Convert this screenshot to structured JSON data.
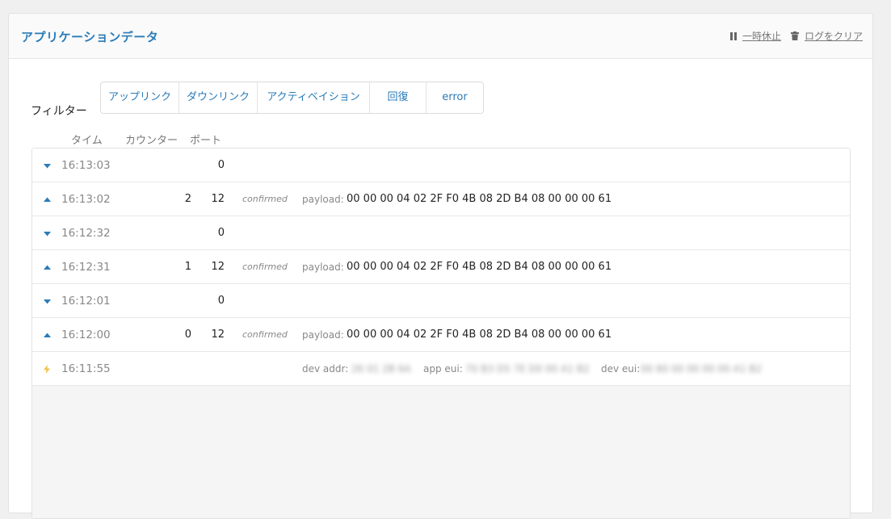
{
  "card": {
    "title": "アプリケーションデータ",
    "actions": {
      "pause_label": "一時休止",
      "clear_label": "ログをクリア"
    }
  },
  "filter": {
    "label": "フィルター",
    "buttons": [
      "アップリンク",
      "ダウンリンク",
      "アクティベイション",
      "回復",
      "error"
    ]
  },
  "columns": {
    "time": "タイム",
    "counter": "カウンター",
    "port": "ポート"
  },
  "rows": [
    {
      "direction": "down",
      "time": "16:13:03",
      "counter": "",
      "port": "0",
      "confirmed": "",
      "payload_label": "",
      "payload": ""
    },
    {
      "direction": "up",
      "time": "16:13:02",
      "counter": "2",
      "port": "12",
      "confirmed": "confirmed",
      "payload_label": "payload:",
      "payload": "00 00 00 04 02 2F F0 4B 08 2D B4 08 00 00 00 61"
    },
    {
      "direction": "down",
      "time": "16:12:32",
      "counter": "",
      "port": "0",
      "confirmed": "",
      "payload_label": "",
      "payload": ""
    },
    {
      "direction": "up",
      "time": "16:12:31",
      "counter": "1",
      "port": "12",
      "confirmed": "confirmed",
      "payload_label": "payload:",
      "payload": "00 00 00 04 02 2F F0 4B 08 2D B4 08 00 00 00 61"
    },
    {
      "direction": "down",
      "time": "16:12:01",
      "counter": "",
      "port": "0",
      "confirmed": "",
      "payload_label": "",
      "payload": ""
    },
    {
      "direction": "up",
      "time": "16:12:00",
      "counter": "0",
      "port": "12",
      "confirmed": "confirmed",
      "payload_label": "payload:",
      "payload": "00 00 00 04 02 2F F0 4B 08 2D B4 08 00 00 00 61"
    }
  ],
  "activation": {
    "time": "16:11:55",
    "dev_addr_label": "dev addr:",
    "dev_addr": "26 01 2B 6A",
    "app_eui_label": "app eui:",
    "app_eui": "70 B3 D5 7E D0 00 A1 B2",
    "dev_eui_label": "dev eui:",
    "dev_eui": "00 80 00 00 00 00 A1 B2"
  },
  "colors": {
    "accent": "#2a7bb8",
    "activation": "#f0c040"
  }
}
